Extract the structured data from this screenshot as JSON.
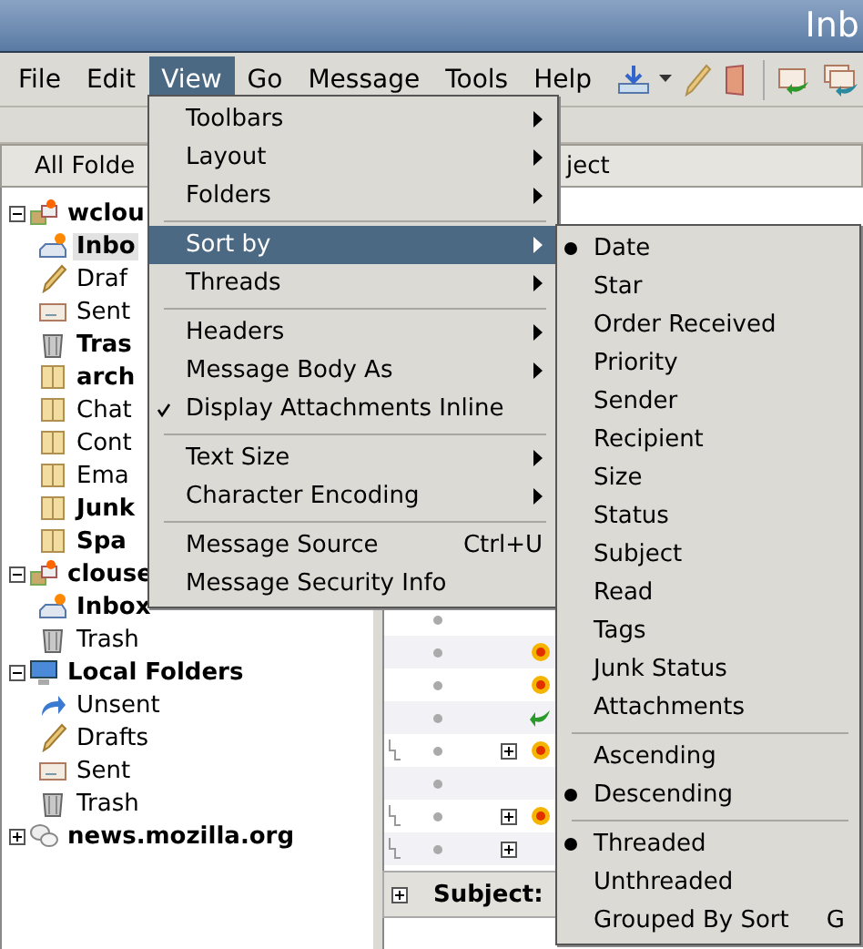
{
  "window": {
    "title": "Inb"
  },
  "menubar": [
    {
      "label": "File",
      "selected": false
    },
    {
      "label": "Edit",
      "selected": false
    },
    {
      "label": "View",
      "selected": true
    },
    {
      "label": "Go",
      "selected": false
    },
    {
      "label": "Message",
      "selected": false
    },
    {
      "label": "Tools",
      "selected": false
    },
    {
      "label": "Help",
      "selected": false
    }
  ],
  "folder_pane": {
    "header": "All Folde",
    "tree": [
      {
        "label": "wclou",
        "kind": "account",
        "bold": true,
        "selected": false,
        "expanded": true,
        "children": [
          {
            "label": "Inbo",
            "kind": "inbox",
            "bold": true,
            "selected": true
          },
          {
            "label": "Draf",
            "kind": "drafts",
            "bold": false,
            "selected": false
          },
          {
            "label": "Sent",
            "kind": "sent",
            "bold": false,
            "selected": false
          },
          {
            "label": "Tras",
            "kind": "trash",
            "bold": true,
            "selected": false
          },
          {
            "label": "arch",
            "kind": "folder",
            "bold": true,
            "selected": false
          },
          {
            "label": "Chat",
            "kind": "folder",
            "bold": false,
            "selected": false
          },
          {
            "label": "Cont",
            "kind": "folder",
            "bold": false,
            "selected": false
          },
          {
            "label": "Ema",
            "kind": "folder",
            "bold": false,
            "selected": false
          },
          {
            "label": "Junk",
            "kind": "folder",
            "bold": true,
            "selected": false
          },
          {
            "label": "Spa",
            "kind": "folder",
            "bold": true,
            "selected": false
          }
        ]
      },
      {
        "label": "clouse",
        "kind": "account",
        "bold": true,
        "selected": false,
        "expanded": true,
        "children": [
          {
            "label": "Inbox",
            "kind": "inbox",
            "bold": true,
            "selected": false
          },
          {
            "label": "Trash",
            "kind": "trash",
            "bold": false,
            "selected": false
          }
        ]
      },
      {
        "label": "Local Folders",
        "kind": "local",
        "bold": true,
        "selected": false,
        "expanded": true,
        "children": [
          {
            "label": "Unsent",
            "kind": "unsent",
            "bold": false,
            "selected": false
          },
          {
            "label": "Drafts",
            "kind": "drafts",
            "bold": false,
            "selected": false
          },
          {
            "label": "Sent",
            "kind": "sent",
            "bold": false,
            "selected": false
          },
          {
            "label": "Trash",
            "kind": "trash",
            "bold": false,
            "selected": false
          }
        ]
      },
      {
        "label": "news.mozilla.org",
        "kind": "news",
        "bold": true,
        "selected": false,
        "expanded": false
      }
    ]
  },
  "message_list": {
    "header": "ject",
    "rows": [
      {
        "thread": false,
        "expandable": false,
        "new": false,
        "replied": false
      },
      {
        "thread": false,
        "expandable": false,
        "new": true,
        "replied": false
      },
      {
        "thread": false,
        "expandable": false,
        "new": true,
        "replied": false
      },
      {
        "thread": false,
        "expandable": false,
        "new": false,
        "replied": true
      },
      {
        "thread": true,
        "expandable": true,
        "new": true,
        "replied": false
      },
      {
        "thread": false,
        "expandable": false,
        "new": false,
        "replied": false
      },
      {
        "thread": true,
        "expandable": true,
        "new": true,
        "replied": false
      },
      {
        "thread": true,
        "expandable": true,
        "new": false,
        "replied": false
      }
    ]
  },
  "preview": {
    "header_label": "Subject:"
  },
  "view_menu": {
    "groups": [
      [
        {
          "label": "Toolbars",
          "kind": "submenu",
          "selected": false
        },
        {
          "label": "Layout",
          "kind": "submenu",
          "selected": false
        },
        {
          "label": "Folders",
          "kind": "submenu",
          "selected": false
        }
      ],
      [
        {
          "label": "Sort by",
          "kind": "submenu",
          "selected": true
        },
        {
          "label": "Threads",
          "kind": "submenu",
          "selected": false
        }
      ],
      [
        {
          "label": "Headers",
          "kind": "submenu",
          "selected": false
        },
        {
          "label": "Message Body As",
          "kind": "submenu",
          "selected": false
        },
        {
          "label": "Display Attachments Inline",
          "kind": "check",
          "checked": true,
          "selected": false
        }
      ],
      [
        {
          "label": "Text Size",
          "kind": "submenu",
          "selected": false
        },
        {
          "label": "Character Encoding",
          "kind": "submenu",
          "selected": false
        }
      ],
      [
        {
          "label": "Message Source",
          "kind": "command",
          "shortcut": "Ctrl+U",
          "selected": false
        },
        {
          "label": "Message Security Info",
          "kind": "command",
          "selected": false
        }
      ]
    ]
  },
  "sort_menu": {
    "groups": [
      [
        {
          "label": "Date",
          "checked": true
        },
        {
          "label": "Star",
          "checked": false
        },
        {
          "label": "Order Received",
          "checked": false
        },
        {
          "label": "Priority",
          "checked": false
        },
        {
          "label": "Sender",
          "checked": false
        },
        {
          "label": "Recipient",
          "checked": false
        },
        {
          "label": "Size",
          "checked": false
        },
        {
          "label": "Status",
          "checked": false
        },
        {
          "label": "Subject",
          "checked": false
        },
        {
          "label": "Read",
          "checked": false
        },
        {
          "label": "Tags",
          "checked": false
        },
        {
          "label": "Junk Status",
          "checked": false
        },
        {
          "label": "Attachments",
          "checked": false
        }
      ],
      [
        {
          "label": "Ascending",
          "checked": false
        },
        {
          "label": "Descending",
          "checked": true
        }
      ],
      [
        {
          "label": "Threaded",
          "checked": true
        },
        {
          "label": "Unthreaded",
          "checked": false
        },
        {
          "label": "Grouped By Sort",
          "checked": false,
          "shortcut": "G"
        }
      ]
    ]
  }
}
